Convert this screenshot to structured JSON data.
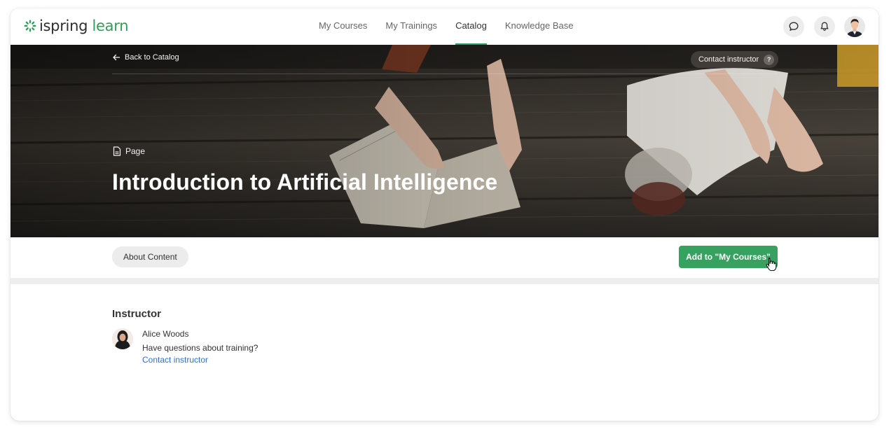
{
  "app": {
    "logo_brand": "ispring",
    "logo_product": "learn"
  },
  "nav": {
    "items": [
      {
        "label": "My Courses",
        "active": false
      },
      {
        "label": "My Trainings",
        "active": false
      },
      {
        "label": "Catalog",
        "active": true
      },
      {
        "label": "Knowledge Base",
        "active": false
      }
    ],
    "icons": [
      "chat-icon",
      "bell-icon",
      "user-avatar"
    ]
  },
  "hero": {
    "back_label": "Back to Catalog",
    "contact_label": "Contact instructor",
    "help_glyph": "?",
    "content_type": "Page",
    "title": "Introduction to Artificial Intelligence"
  },
  "actions": {
    "about_label": "About Content",
    "add_label": "Add to \"My Courses\""
  },
  "instructor": {
    "heading": "Instructor",
    "name": "Alice Woods",
    "question": "Have questions about training?",
    "contact_link": "Contact instructor"
  },
  "colors": {
    "accent": "#36a25f",
    "link": "#2f6fc8",
    "brand": "#2f9e5b"
  }
}
